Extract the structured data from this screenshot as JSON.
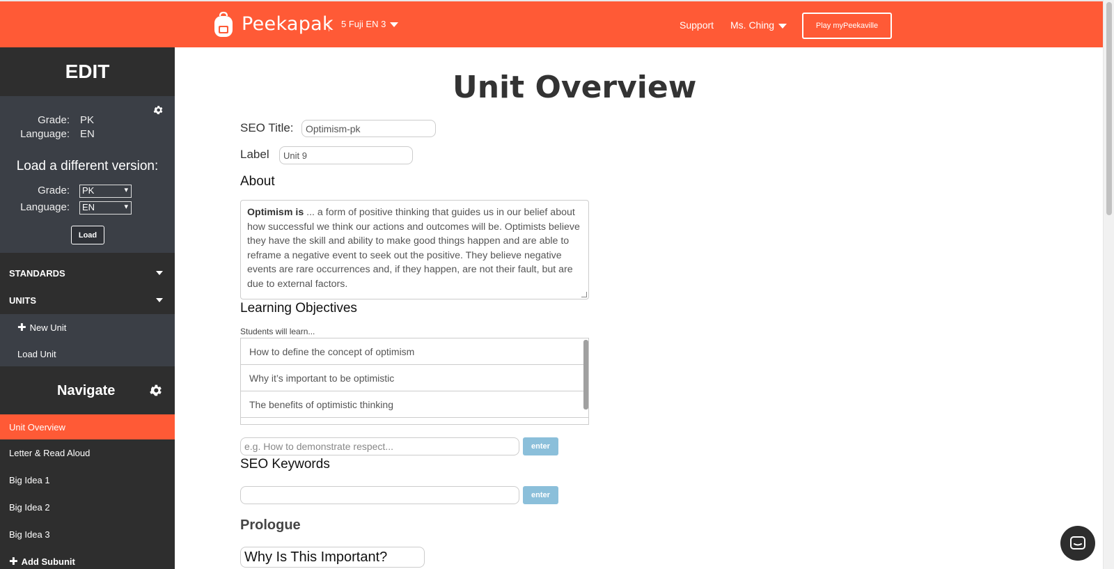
{
  "header": {
    "brand": "Peekapak",
    "class_name": "5 Fuji EN 3",
    "support": "Support",
    "user": "Ms. Ching",
    "play_button": "Play myPeekaville"
  },
  "sidebar": {
    "edit_title": "EDIT",
    "current": {
      "grade_label": "Grade:",
      "grade_value": "PK",
      "language_label": "Language:",
      "language_value": "EN"
    },
    "load_version": {
      "heading": "Load a different version:",
      "grade_label": "Grade:",
      "grade_selected": "PK",
      "language_label": "Language:",
      "language_selected": "EN",
      "load_button": "Load"
    },
    "standards_label": "STANDARDS",
    "units_label": "UNITS",
    "new_unit": "New Unit",
    "load_unit": "Load Unit",
    "navigate_title": "Navigate",
    "nav_items": [
      {
        "label": "Unit Overview",
        "active": true
      },
      {
        "label": "Letter & Read Aloud",
        "active": false
      },
      {
        "label": "Big Idea 1",
        "active": false
      },
      {
        "label": "Big Idea 2",
        "active": false
      },
      {
        "label": "Big Idea 3",
        "active": false
      }
    ],
    "add_subunit": "Add Subunit"
  },
  "main": {
    "title": "Unit Overview",
    "seo_title_label": "SEO Title:",
    "seo_title_value": "Optimism-pk",
    "label_label": "Label",
    "label_value": "Unit 9",
    "about_heading": "About",
    "about_bold": "Optimism is",
    "about_text": " ... a form of positive thinking that guides us in our belief about how successful we think our actions and outcomes will be. Optimists believe they have the skill and ability to make good things happen and are able to reframe a negative event to seek out the positive. They believe negative events are rare occurrences and, if they happen, are not their fault, but are due to external factors.",
    "objectives_heading": "Learning Objectives",
    "objectives_note": "Students will learn...",
    "objectives": [
      "How to define the concept of optimism",
      "Why it’s important to be optimistic",
      "The benefits of optimistic thinking"
    ],
    "objective_placeholder": "e.g. How to demonstrate respect...",
    "enter_label": "enter",
    "seo_keywords_heading": "SEO Keywords",
    "seo_keywords_value": "",
    "prologue_heading": "Prologue",
    "prologue_title_value": "Why Is This Important?"
  },
  "colors": {
    "brand": "#ff5a36",
    "sidebar_dark": "#2e2e2e",
    "sidebar_panel": "#3b3f46",
    "enter_button": "#8bbfda"
  }
}
